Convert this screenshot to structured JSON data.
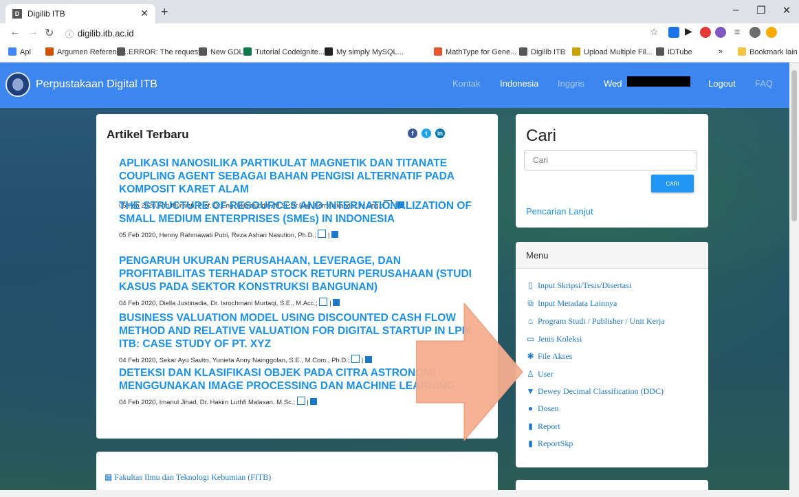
{
  "browser": {
    "tab_title": "Digilib ITB",
    "tab_favicon": "digilib-icon",
    "url": "digilib.itb.ac.id",
    "bookmarks": [
      {
        "label": "Apl",
        "icon": "apps-icon",
        "color": "#4285f4"
      },
      {
        "label": "Argumen Referensi...",
        "icon": "fire-icon",
        "color": "#d35400"
      },
      {
        "label": "ERROR: The request...",
        "icon": "globe-icon",
        "color": "#555555"
      },
      {
        "label": "New GDL",
        "icon": "digilib-icon",
        "color": "#555555"
      },
      {
        "label": "Tutorial Codeignite...",
        "icon": "globe-icon",
        "color": "#0b7a4a"
      },
      {
        "label": "My simply MySQL...",
        "icon": "github-icon",
        "color": "#222222"
      },
      {
        "label": "MathType for Gene...",
        "icon": "mathtype-icon",
        "color": "#e8542e"
      },
      {
        "label": "Digilib ITB",
        "icon": "digilib-icon",
        "color": "#555555"
      },
      {
        "label": "Upload Multiple Fil...",
        "icon": "cv-icon",
        "color": "#c8a200"
      },
      {
        "label": "IDTube",
        "icon": "globe-icon",
        "color": "#555555"
      }
    ],
    "bookmark_overflow": "»",
    "other_bookmarks": "Bookmark lain"
  },
  "navbar": {
    "brand": "Perpustakaan Digital ITB",
    "links": [
      {
        "label": "Kontak",
        "color": "#a9c9f7"
      },
      {
        "label": "Indonesia",
        "color": "#ffffff"
      },
      {
        "label": "Inggris",
        "color": "#a9c9f7"
      },
      {
        "label": "Wed",
        "color": "#ffffff"
      }
    ],
    "logout": "Logout",
    "faq": "FAQ"
  },
  "articles": {
    "title": "Artikel Terbaru",
    "social": [
      "f",
      "t",
      "in"
    ],
    "items": [
      {
        "title": "APLIKASI NANOSILIKA PARTIKULAT MAGNETIK DAN TITANATE COUPLING AGENT SEBAGAI BAHAN PENGISI ALTERNATIF PADA KOMPOSIT KARET ALAM",
        "meta": "05 Feb 2020, Riri Murniati, Prof. Dr.Eng. Mikrajuddin, M.Si.;Dr.Eng. Ferry Iskandar, M.Eng.;"
      },
      {
        "title": "THE STRUCTURE OF RESOURCES AND INTERNATIONALIZATION OF SMALL MEDIUM ENTERPRISES (SMEs) IN INDONESIA",
        "meta": "05 Feb 2020, Henny Rahmawati Putri, Reza Ashari Nasution, Ph.D.;"
      },
      {
        "title": "PENGARUH UKURAN PERUSAHAAN, LEVERAGE, DAN PROFITABILITAS TERHADAP STOCK RETURN PERUSAHAAN (STUDI KASUS PADA SEKTOR KONSTRUKSI BANGUNAN)",
        "meta": "04 Feb 2020, Diella Justinadia, Dr. Isrochmani Murtaqi, S.E., M.Acc.;"
      },
      {
        "title": "BUSINESS VALUATION MODEL USING DISCOUNTED CASH FLOW METHOD AND RELATIVE VALUATION FOR DIGITAL STARTUP IN LPIK ITB: CASE STUDY OF PT. XYZ",
        "meta": "04 Feb 2020, Sekar Ayu Savitri, Yunieta Anny Nainggolan, S.E., M.Com., Ph.D.;"
      },
      {
        "title": "DETEKSI DAN KLASIFIKASI OBJEK PADA CITRA ASTRONOMI MENGGUNAKAN IMAGE PROCESSING DAN MACHINE LEARNING",
        "meta": "04 Feb 2020, Imanul Jihad, Dr. Hakim Luthfi Malasan, M.Sc.;"
      }
    ]
  },
  "search": {
    "title": "Cari",
    "placeholder": "Cari",
    "button": "CARI",
    "advanced": "Pencarian Lanjut"
  },
  "menu": {
    "title": "Menu",
    "items": [
      {
        "label": "Input Skripsi/Tesis/Disertasi",
        "icon": "file-icon",
        "glyph": "▯"
      },
      {
        "label": "Input Metadata Lainnya",
        "icon": "copy-icon",
        "glyph": "⧉"
      },
      {
        "label": "Program Studi / Publisher / Unit Kerja",
        "icon": "institution-icon",
        "glyph": "⌂"
      },
      {
        "label": "Jenis Koleksi",
        "icon": "folder-icon",
        "glyph": "▭"
      },
      {
        "label": "File Akses",
        "icon": "gear-icon",
        "glyph": "✱"
      },
      {
        "label": "User",
        "icon": "user-icon",
        "glyph": "♙"
      },
      {
        "label": "Dewey Decimal Classification (DDC)",
        "icon": "filter-icon",
        "glyph": "▼"
      },
      {
        "label": "Dosen",
        "icon": "user-circle-icon",
        "glyph": "●"
      },
      {
        "label": "Report",
        "icon": "file-text-icon",
        "glyph": "▮"
      },
      {
        "label": "ReportSkp",
        "icon": "file-text-icon",
        "glyph": "▮"
      }
    ]
  },
  "faculty": {
    "first": "Fakultas Ilmu dan Teknologi Kebumian (FITB)"
  },
  "annotation": {
    "shape": "arrow-right",
    "color": "#f5ae8e"
  },
  "colors": {
    "navbar": "#3c86f0",
    "link": "#1e90e8",
    "button": "#2196f3"
  }
}
